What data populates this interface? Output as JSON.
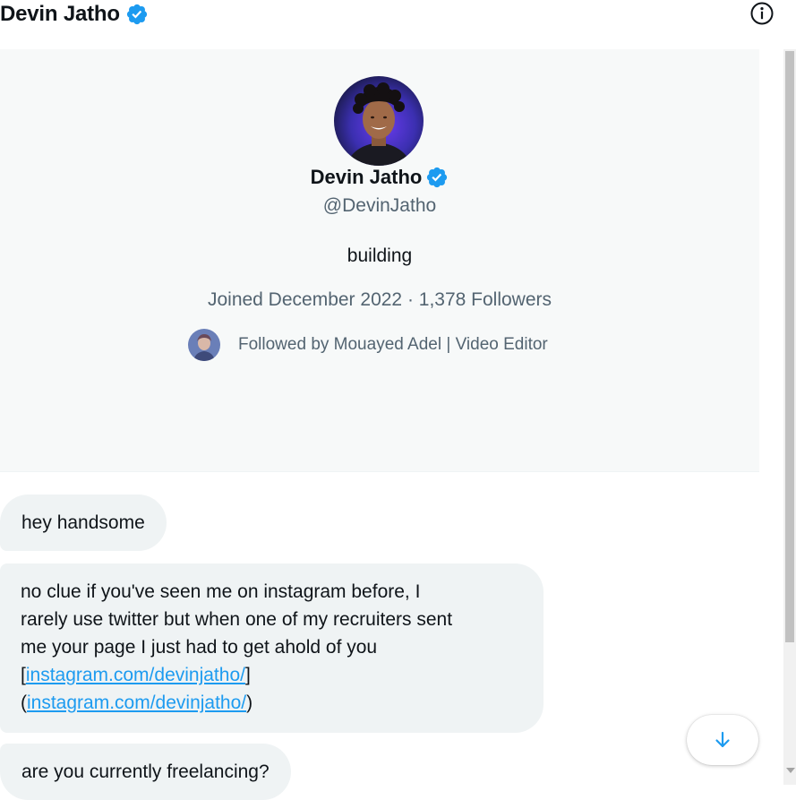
{
  "header": {
    "title": "Devin Jatho",
    "verified_icon": "verified-badge-icon",
    "info_icon": "info-icon"
  },
  "profile": {
    "name": "Devin Jatho",
    "handle": "@DevinJatho",
    "bio": "building",
    "meta": "Joined December 2022 · 1,378 Followers",
    "followed_by": "Followed by Mouayed Adel | Video Editor"
  },
  "messages": [
    {
      "text": "hey handsome"
    },
    {
      "line1": "no clue if you've seen me on instagram before, I",
      "line2": "rarely use twitter but when one of my recruiters sent",
      "line3": "me your page I just had to get ahold of you",
      "link_open_1": "[",
      "link1": "instagram.com/devinjatho/",
      "link_close_1": "]",
      "link_open_2": "(",
      "link2": "instagram.com/devinjatho/",
      "link_close_2": ")"
    },
    {
      "text": "are you currently freelancing?"
    }
  ],
  "scroll_button_icon": "arrow-down-icon",
  "colors": {
    "accent": "#1d9bf0",
    "text": "#0f1419",
    "muted": "#536471",
    "bubble": "#eff3f4",
    "card": "#f7f9f9"
  }
}
